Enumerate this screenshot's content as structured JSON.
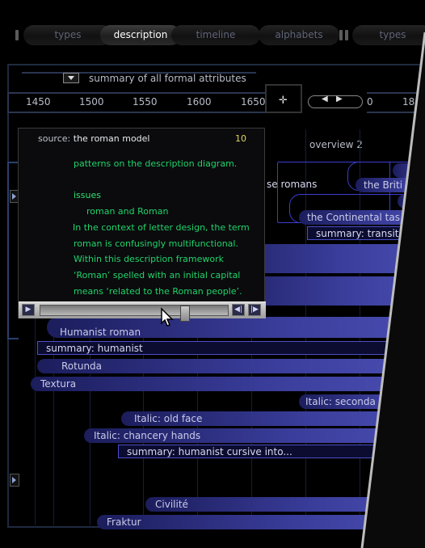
{
  "tabs": [
    {
      "label": "types",
      "active": false
    },
    {
      "label": "description",
      "active": true
    },
    {
      "label": "timeline",
      "active": false
    },
    {
      "label": "alphabets",
      "active": false
    },
    {
      "label": "types",
      "active": false
    }
  ],
  "summary_dropdown": "summary of all formal attributes",
  "ruler_years": [
    "1450",
    "1500",
    "1550",
    "1600",
    "1650"
  ],
  "ruler2_years": [
    "0",
    "18"
  ],
  "overview_label": "overview 2",
  "popup": {
    "source_label": "source:",
    "source_title": "the roman model",
    "number": "10",
    "lines": [
      "patterns on the description diagram.",
      "",
      "issues",
      "roman and Roman",
      "In the context of letter design, the term",
      "roman is confusingly multifunctional.",
      "Within this description framework",
      "‘Roman’ spelled with an initial capital",
      "means ‘related to the Roman people’."
    ]
  },
  "bars": {
    "the_british": "the Briti",
    "se_romans": "se romans",
    "continental": "the Continental tas",
    "summary_transit": "summary: transiti",
    "humanist_roman": "Humanist roman",
    "summary_humanist": "summary: humanist",
    "rotunda": "Rotunda",
    "textura": "Textura",
    "italic_secondary": "Italic: seconda",
    "italic_old_face": "Italic: old face",
    "italic_chancery": "Italic: chancery hands",
    "summary_cursive": "summary: humanist cursive into...",
    "civilite": "Civilité",
    "fraktur": "Fraktur"
  },
  "colors": {
    "accent_green": "#1fd46a",
    "accent_yellow": "#e2d65a",
    "bar_blue": "#3a3d9a"
  }
}
